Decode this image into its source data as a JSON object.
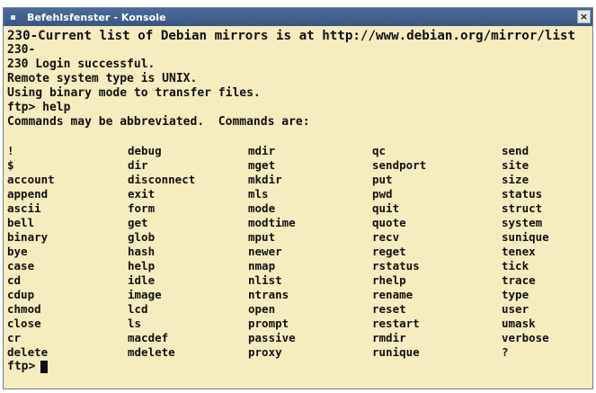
{
  "window": {
    "title": "Befehlsfenster - Konsole",
    "close_label": "×"
  },
  "terminal": {
    "lines": [
      "230-Current list of Debian mirrors is at http://www.debian.org/mirror/list",
      "230-",
      "230 Login successful.",
      "Remote system type is UNIX.",
      "Using binary mode to transfer files.",
      "ftp> help",
      "Commands may be abbreviated.  Commands are:",
      ""
    ],
    "commands": [
      "!",
      "debug",
      "mdir",
      "qc",
      "send",
      "$",
      "dir",
      "mget",
      "sendport",
      "site",
      "account",
      "disconnect",
      "mkdir",
      "put",
      "size",
      "append",
      "exit",
      "mls",
      "pwd",
      "status",
      "ascii",
      "form",
      "mode",
      "quit",
      "struct",
      "bell",
      "get",
      "modtime",
      "quote",
      "system",
      "binary",
      "glob",
      "mput",
      "recv",
      "sunique",
      "bye",
      "hash",
      "newer",
      "reget",
      "tenex",
      "case",
      "help",
      "nmap",
      "rstatus",
      "tick",
      "cd",
      "idle",
      "nlist",
      "rhelp",
      "trace",
      "cdup",
      "image",
      "ntrans",
      "rename",
      "type",
      "chmod",
      "lcd",
      "open",
      "reset",
      "user",
      "close",
      "ls",
      "prompt",
      "restart",
      "umask",
      "cr",
      "macdef",
      "passive",
      "rmdir",
      "verbose",
      "delete",
      "mdelete",
      "proxy",
      "runique",
      "?"
    ],
    "prompt": "ftp>"
  },
  "colors": {
    "terminal_bg": "#f5ecbf",
    "terminal_fg": "#111111",
    "titlebar": "#4a6898"
  }
}
